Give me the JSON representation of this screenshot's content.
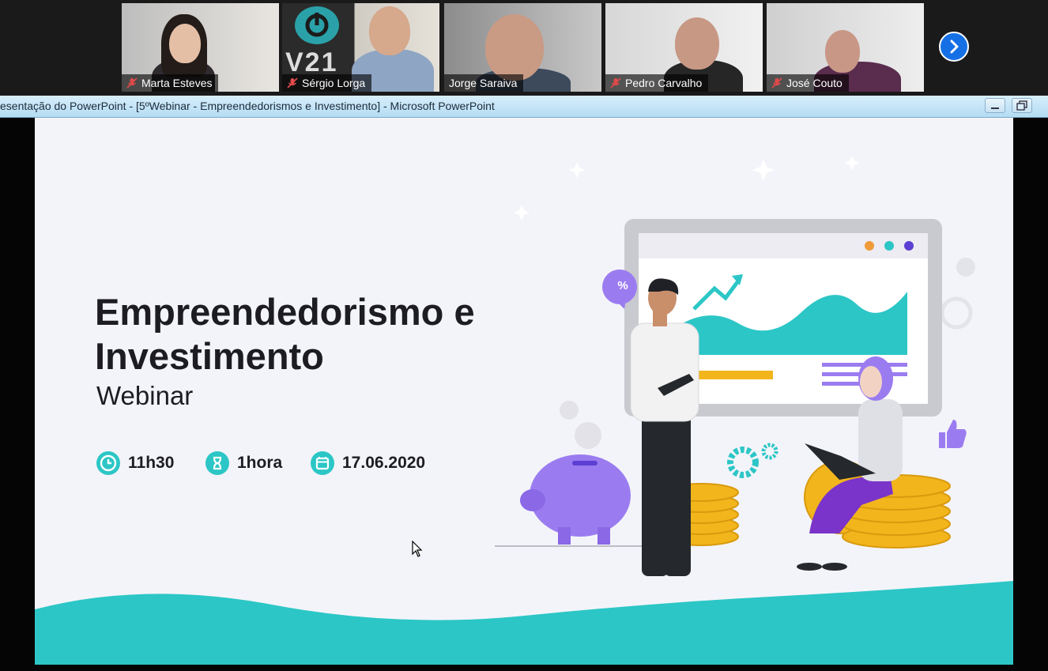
{
  "participants": [
    {
      "name": "Marta Esteves",
      "muted": true
    },
    {
      "name": "Sérgio Lorga",
      "muted": true,
      "active_speaker": true,
      "background_text": "V21"
    },
    {
      "name": "Jorge Saraiva",
      "muted": false
    },
    {
      "name": "Pedro Carvalho",
      "muted": true
    },
    {
      "name": "José Couto",
      "muted": true
    }
  ],
  "gallery": {
    "next_icon": "chevron-right-icon"
  },
  "window": {
    "title": "esentação do PowerPoint - [5ºWebinar - Empreendedorismos e Investimento] - Microsoft PowerPoint",
    "minimize_icon": "minimize-icon",
    "restore_icon": "restore-icon"
  },
  "slide": {
    "title": "Empreendedorismo e Investimento",
    "subtitle": "Webinar",
    "time": "11h30",
    "duration": "1hora",
    "date": "17.06.2020",
    "badge": "%",
    "colors": {
      "teal": "#2cc6c6",
      "purple": "#9b7cf0",
      "gold": "#f2b51c",
      "dark": "#1c1c22",
      "background": "#f3f4f9"
    }
  }
}
